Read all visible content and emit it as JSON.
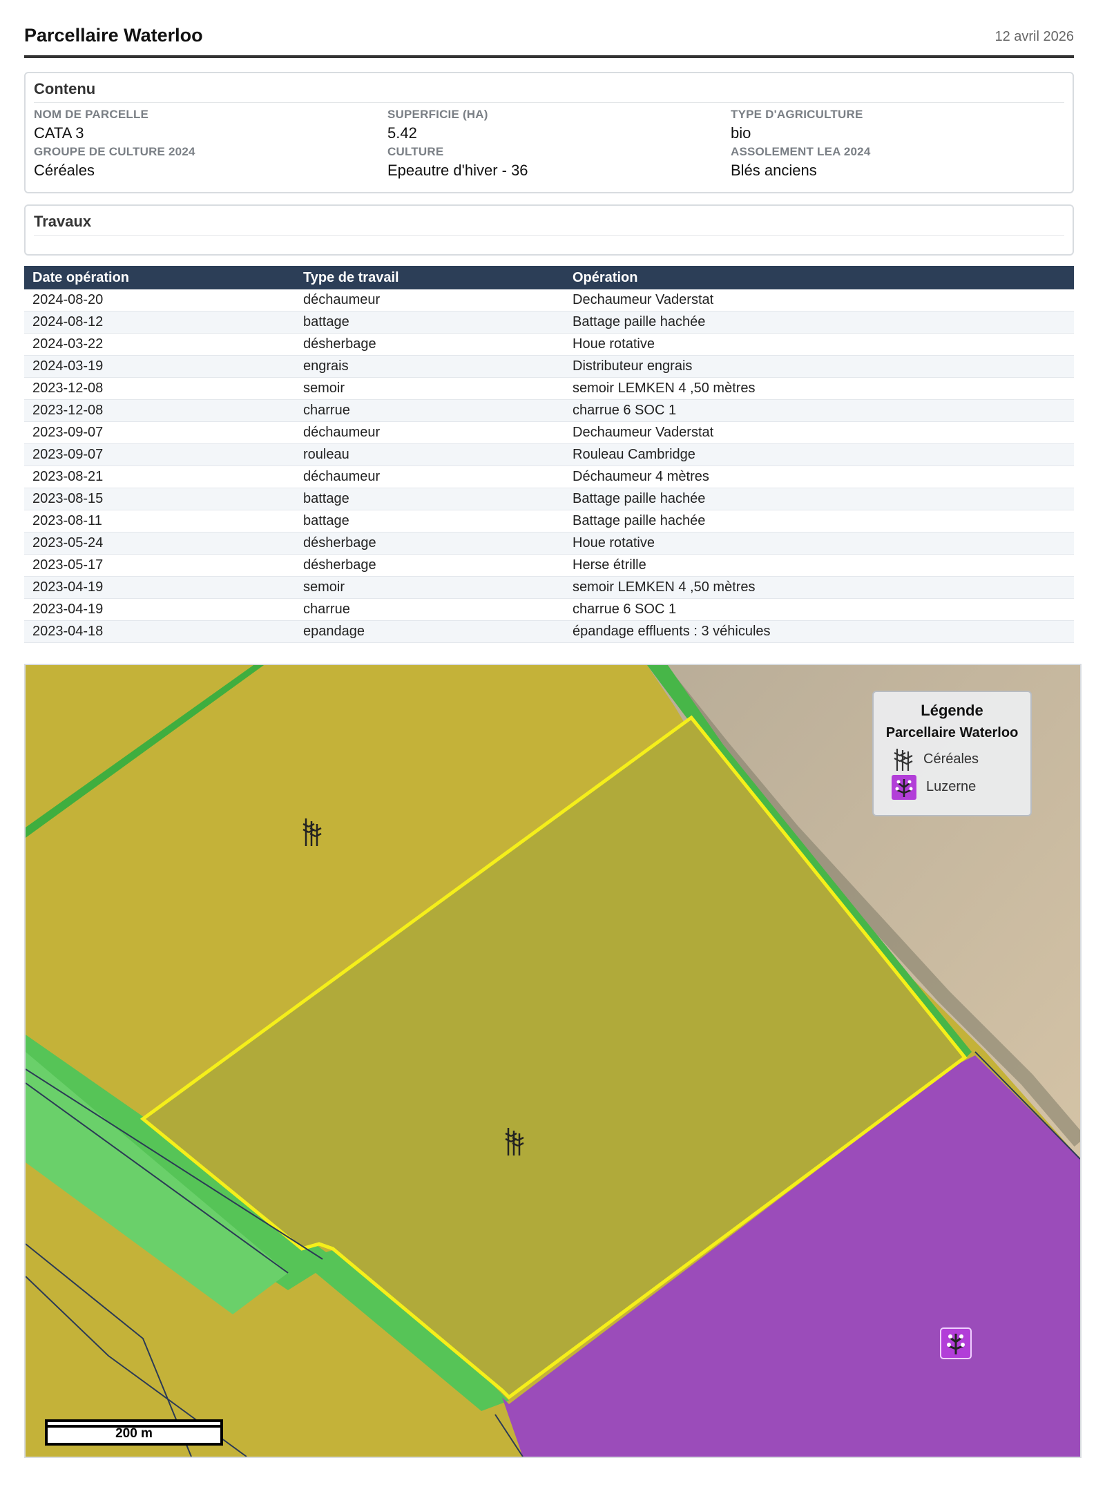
{
  "header": {
    "title": "Parcellaire Waterloo",
    "date": "12 avril 2026"
  },
  "contenu": {
    "title": "Contenu",
    "fields": [
      {
        "label": "NOM DE PARCELLE",
        "value": "CATA 3"
      },
      {
        "label": "SUPERFICIE (HA)",
        "value": "5.42"
      },
      {
        "label": "TYPE D'AGRICULTURE",
        "value": "bio"
      },
      {
        "label": "GROUPE DE CULTURE 2024",
        "value": "Céréales"
      },
      {
        "label": "CULTURE",
        "value": "Epeautre d'hiver - 36"
      },
      {
        "label": "ASSOLEMENT LEA 2024",
        "value": "Blés anciens"
      }
    ]
  },
  "travaux": {
    "title": "Travaux",
    "columns": [
      "Date opération",
      "Type de travail",
      "Opération"
    ],
    "rows": [
      [
        "2024-08-20",
        "déchaumeur",
        "Dechaumeur Vaderstat"
      ],
      [
        "2024-08-12",
        "battage",
        "Battage paille hachée"
      ],
      [
        "2024-03-22",
        "désherbage",
        "Houe rotative"
      ],
      [
        "2024-03-19",
        "engrais",
        "Distributeur engrais"
      ],
      [
        "2023-12-08",
        "semoir",
        "semoir LEMKEN 4 ,50 mètres"
      ],
      [
        "2023-12-08",
        "charrue",
        "charrue 6 SOC 1"
      ],
      [
        "2023-09-07",
        "déchaumeur",
        "Dechaumeur Vaderstat"
      ],
      [
        "2023-09-07",
        "rouleau",
        "Rouleau Cambridge"
      ],
      [
        "2023-08-21",
        "déchaumeur",
        "Déchaumeur 4 mètres"
      ],
      [
        "2023-08-15",
        "battage",
        "Battage paille hachée"
      ],
      [
        "2023-08-11",
        "battage",
        "Battage paille hachée"
      ],
      [
        "2023-05-24",
        "désherbage",
        "Houe rotative"
      ],
      [
        "2023-05-17",
        "désherbage",
        "Herse étrille"
      ],
      [
        "2023-04-19",
        "semoir",
        "semoir LEMKEN 4 ,50 mètres"
      ],
      [
        "2023-04-19",
        "charrue",
        "charrue 6 SOC 1"
      ],
      [
        "2023-04-18",
        "epandage",
        "épandage effluents : 3 véhicules"
      ]
    ]
  },
  "legend": {
    "title": "Légende",
    "layer": "Parcellaire Waterloo",
    "items": [
      {
        "label": "Céréales",
        "icon": "wheat-icon"
      },
      {
        "label": "Luzerne",
        "icon": "alfalfa-icon",
        "color": "#b23ed8"
      }
    ]
  },
  "map": {
    "scale_label": "200 m",
    "colors": {
      "cereal": "#c9b43a",
      "grass": "#4fbf4f",
      "luzerne": "#9a4fb8",
      "bare_soil": "#c9b89c",
      "selection": "#f5ef1a"
    }
  }
}
